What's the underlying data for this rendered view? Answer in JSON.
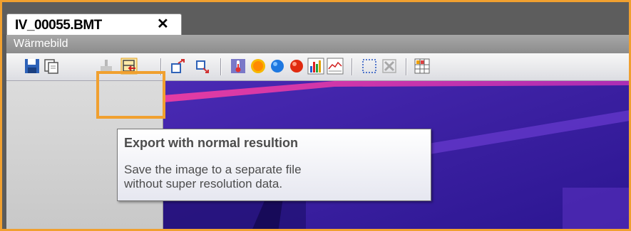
{
  "tab": {
    "label": "IV_00055.BMT",
    "close_glyph": "✕"
  },
  "panel": {
    "title": "Wärmebild"
  },
  "toolbar": {
    "buttons": [
      {
        "icon": "save-icon"
      },
      {
        "icon": "copy-icon"
      },
      {
        "icon": "export-super-resolution-icon"
      },
      {
        "icon": "export-normal-resolution-icon"
      },
      {
        "icon": "rotate-left-icon"
      },
      {
        "icon": "rotate-right-icon"
      },
      {
        "icon": "thermometer-icon"
      },
      {
        "icon": "sun-spot-icon"
      },
      {
        "icon": "blue-spot-icon"
      },
      {
        "icon": "red-spot-icon"
      },
      {
        "icon": "histogram-icon"
      },
      {
        "icon": "profile-chart-icon"
      },
      {
        "icon": "selection-rectangle-icon"
      },
      {
        "icon": "delete-marker-icon"
      },
      {
        "icon": "palette-grid-icon"
      }
    ]
  },
  "tooltip": {
    "title": "Export with normal resultion",
    "line1": "Save the image to a separate file",
    "line2": "without super resolution data."
  },
  "colors": {
    "highlight": "#f0a030",
    "thermal_base": "#3a1fa0",
    "thermal_hot": "#ff4fa8"
  }
}
